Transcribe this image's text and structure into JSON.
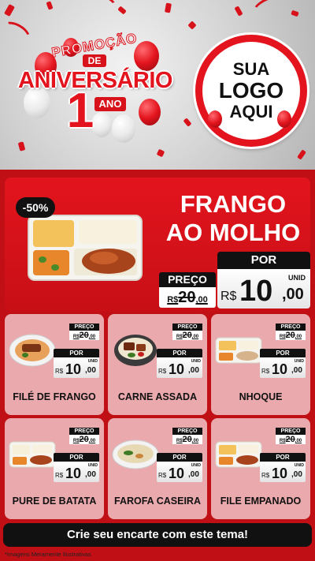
{
  "header": {
    "promo_word": "PROMOÇÃO",
    "de_label": "DE",
    "aniversario": "ANIVERSÁRIO",
    "anniversary_number": "1",
    "ano_label": "ANO",
    "logo": {
      "line1": "SUA",
      "line2": "LOGO",
      "line3": "AQUI"
    }
  },
  "hero": {
    "discount": "-50%",
    "title_line1": "FRANGO",
    "title_line2": "AO MOLHO",
    "old_price": {
      "label": "PREÇO",
      "prefix": "R$",
      "int": "20",
      "dec": ",00"
    },
    "new_price": {
      "label": "POR",
      "currency": "R$",
      "int": "10",
      "dec": ",00",
      "unit": "UNID"
    }
  },
  "products": [
    {
      "name": "FILÉ DE FRANGO",
      "old_label": "PREÇO",
      "old_int": "20",
      "old_dec": ",00",
      "new_label": "POR",
      "currency": "R$",
      "new_int": "10",
      "new_dec": ",00",
      "unit": "UNID"
    },
    {
      "name": "CARNE ASSADA",
      "old_label": "PREÇO",
      "old_int": "20",
      "old_dec": ",00",
      "new_label": "POR",
      "currency": "R$",
      "new_int": "10",
      "new_dec": ",00",
      "unit": "UNID"
    },
    {
      "name": "NHOQUE",
      "old_label": "PREÇO",
      "old_int": "20",
      "old_dec": ",00",
      "new_label": "POR",
      "currency": "R$",
      "new_int": "10",
      "new_dec": ",00",
      "unit": "UNID"
    },
    {
      "name": "PURE DE BATATA",
      "old_label": "PREÇO",
      "old_int": "20",
      "old_dec": ",00",
      "new_label": "POR",
      "currency": "R$",
      "new_int": "10",
      "new_dec": ",00",
      "unit": "UNID"
    },
    {
      "name": "FAROFA CASEIRA",
      "old_label": "PREÇO",
      "old_int": "20",
      "old_dec": ",00",
      "new_label": "POR",
      "currency": "R$",
      "new_int": "10",
      "new_dec": ",00",
      "unit": "UNID"
    },
    {
      "name": "FILE EMPANADO",
      "old_label": "PREÇO",
      "old_int": "20",
      "old_dec": ",00",
      "new_label": "POR",
      "currency": "R$",
      "new_int": "10",
      "new_dec": ",00",
      "unit": "UNID"
    }
  ],
  "footer": {
    "cta": "Crie seu encarte com este tema!",
    "disclaimer": "*Imagens Meramente Ilustrativas"
  },
  "colors": {
    "brand_red": "#e3141d",
    "panel_red": "#c01015",
    "card_pink": "#e9a9ad",
    "black": "#111111"
  },
  "icons": [
    "balloon-icon",
    "confetti-icon",
    "food-tray-icon",
    "food-bowl-icon"
  ]
}
